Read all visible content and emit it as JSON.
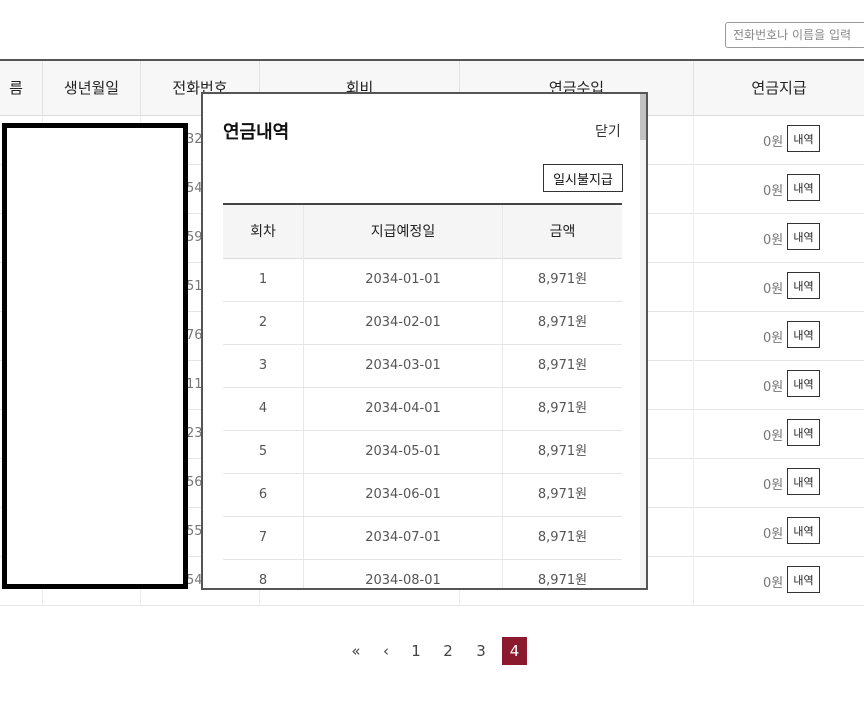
{
  "search": {
    "placeholder": "전화번호나 이름을 입력"
  },
  "table": {
    "headers": [
      "름",
      "생년월일",
      "전화번호",
      "회비",
      "연금수입",
      "연금지급"
    ],
    "rows": [
      {
        "phone_tail": "32",
        "amount": "0원",
        "detail": "내역"
      },
      {
        "phone_tail": "54",
        "amount": "0원",
        "detail": "내역"
      },
      {
        "phone_tail": "59",
        "amount": "0원",
        "detail": "내역"
      },
      {
        "phone_tail": "51",
        "amount": "0원",
        "detail": "내역"
      },
      {
        "phone_tail": "76",
        "amount": "0원",
        "detail": "내역"
      },
      {
        "phone_tail": "11",
        "amount": "0원",
        "detail": "내역"
      },
      {
        "phone_tail": "23",
        "amount": "0원",
        "detail": "내역"
      },
      {
        "phone_tail": "56",
        "amount": "0원",
        "detail": "내역"
      },
      {
        "phone_tail": "55",
        "amount": "0원",
        "detail": "내역"
      },
      {
        "phone_tail": "54",
        "amount": "0원",
        "detail": "내역"
      }
    ]
  },
  "modal": {
    "title": "연금내역",
    "close_label": "닫기",
    "lump_sum_label": "일시불지급",
    "headers": [
      "회차",
      "지급예정일",
      "금액"
    ],
    "rows": [
      {
        "no": "1",
        "date": "2034-01-01",
        "amount": "8,971원"
      },
      {
        "no": "2",
        "date": "2034-02-01",
        "amount": "8,971원"
      },
      {
        "no": "3",
        "date": "2034-03-01",
        "amount": "8,971원"
      },
      {
        "no": "4",
        "date": "2034-04-01",
        "amount": "8,971원"
      },
      {
        "no": "5",
        "date": "2034-05-01",
        "amount": "8,971원"
      },
      {
        "no": "6",
        "date": "2034-06-01",
        "amount": "8,971원"
      },
      {
        "no": "7",
        "date": "2034-07-01",
        "amount": "8,971원"
      },
      {
        "no": "8",
        "date": "2034-08-01",
        "amount": "8,971원"
      }
    ]
  },
  "pagination": {
    "first": "«",
    "prev": "‹",
    "pages": [
      "1",
      "2",
      "3",
      "4"
    ],
    "active_page": "4"
  },
  "colors": {
    "accent": "#8b1a2e"
  }
}
